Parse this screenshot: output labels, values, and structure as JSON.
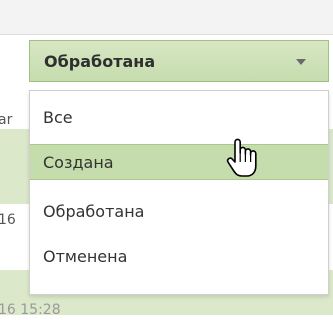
{
  "background": {
    "row_fragment_1": "ar",
    "row_fragment_2": "16",
    "row_fragment_3": "16 15:28"
  },
  "status_select": {
    "selected_value": "Обработана",
    "icon": "chevron-down-icon"
  },
  "status_menu": {
    "items": [
      {
        "label": "Все"
      },
      {
        "label": "Создана",
        "hovered": true
      },
      {
        "label": "Обработана"
      },
      {
        "label": "Отменена"
      }
    ]
  },
  "cursor": {
    "icon": "hand-pointer-icon"
  },
  "colors": {
    "select_bg": "#d7e7c3",
    "hover_bg": "#c5dcac",
    "row_highlight": "#dbe8c9"
  }
}
